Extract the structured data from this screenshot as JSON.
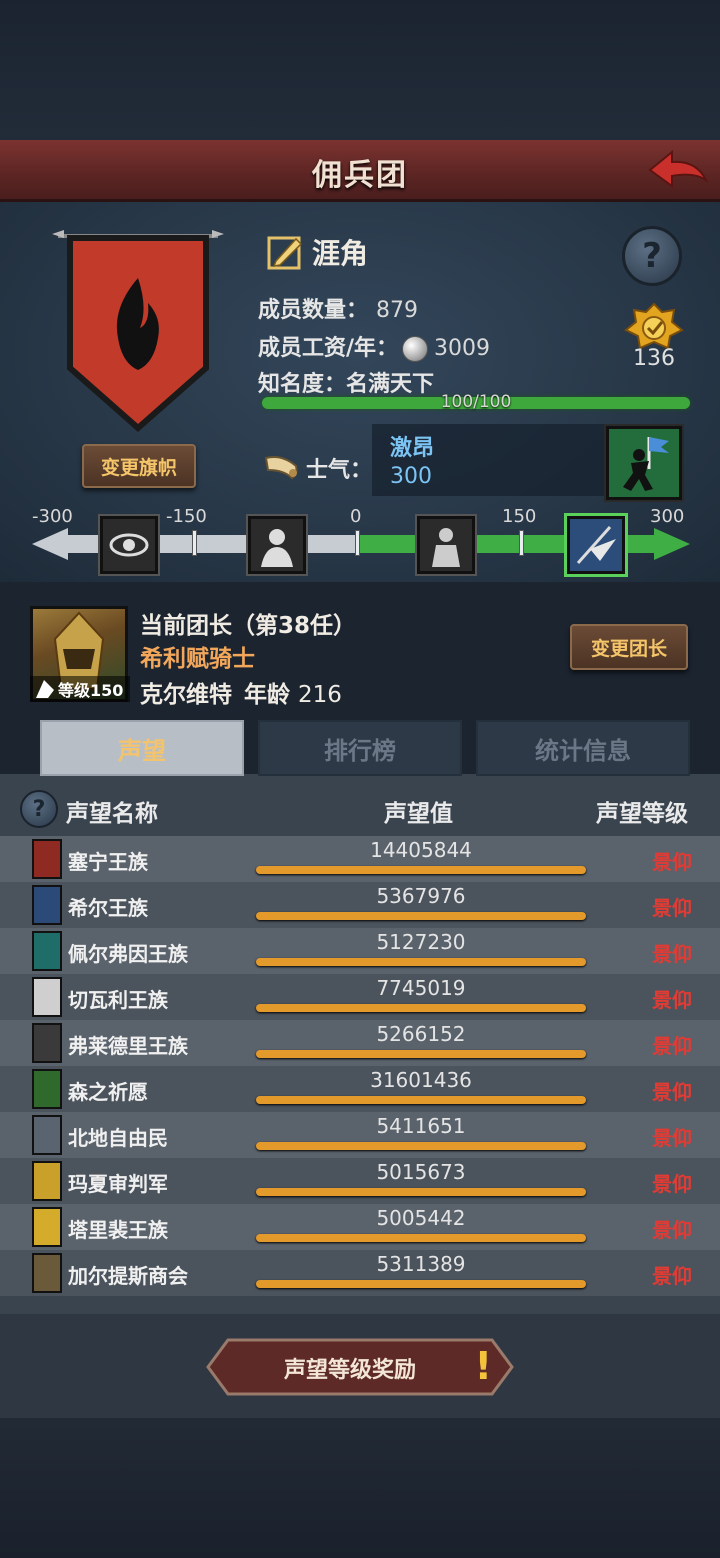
{
  "header": {
    "title": "佣兵团"
  },
  "band": {
    "name": "涯角",
    "change_flag_label": "变更旗帜",
    "member_count_label": "成员数量：",
    "member_count": "879",
    "salary_label": "成员工资/年：",
    "salary": "3009",
    "fame_label": "知名度：",
    "fame_value": "名满天下",
    "fame_progress_text": "100/100",
    "fame_progress": 1.0,
    "badge_count": "136",
    "morale_label": "士气：",
    "morale_state": "激昂",
    "morale_value": "300"
  },
  "morale_scale": {
    "labels": [
      "-300",
      "-150",
      "0",
      "150",
      "300"
    ]
  },
  "leader": {
    "title": "当前团长（第38任）",
    "name": "希利赋骑士",
    "level": "等级150",
    "race": "克尔维特",
    "age_label": "年龄",
    "age": "216",
    "change_leader_label": "变更团长"
  },
  "tabs": [
    {
      "label": "声望",
      "active": true
    },
    {
      "label": "排行榜",
      "active": false
    },
    {
      "label": "统计信息",
      "active": false
    }
  ],
  "columns": {
    "name": "声望名称",
    "value": "声望值",
    "level": "声望等级"
  },
  "factions": [
    {
      "name": "塞宁王族",
      "value": "14405844",
      "level": "景仰",
      "color": "#8f2a22"
    },
    {
      "name": "希尔王族",
      "value": "5367976",
      "level": "景仰",
      "color": "#2c4a78"
    },
    {
      "name": "佩尔弗因王族",
      "value": "5127230",
      "level": "景仰",
      "color": "#1f6d69"
    },
    {
      "name": "切瓦利王族",
      "value": "7745019",
      "level": "景仰",
      "color": "#cfcfcf"
    },
    {
      "name": "弗莱德里王族",
      "value": "5266152",
      "level": "景仰",
      "color": "#3a3a3a"
    },
    {
      "name": "森之祈愿",
      "value": "31601436",
      "level": "景仰",
      "color": "#2f6a2c"
    },
    {
      "name": "北地自由民",
      "value": "5411651",
      "level": "景仰",
      "color": "#5a6470"
    },
    {
      "name": "玛夏审判军",
      "value": "5015673",
      "level": "景仰",
      "color": "#c9a12a"
    },
    {
      "name": "塔里裴王族",
      "value": "5005442",
      "level": "景仰",
      "color": "#d4ab2a"
    },
    {
      "name": "加尔提斯商会",
      "value": "5311389",
      "level": "景仰",
      "color": "#6b5a3a"
    }
  ],
  "reward_button_label": "声望等级奖励",
  "reward_alert": "!"
}
